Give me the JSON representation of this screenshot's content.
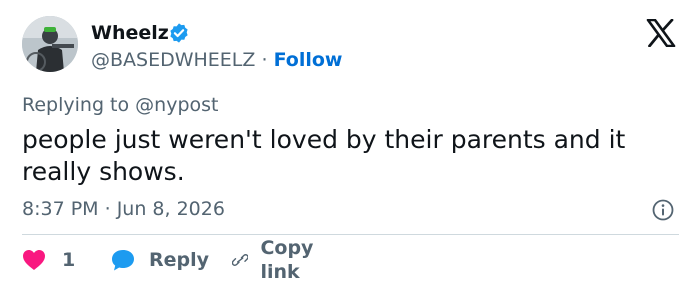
{
  "author": {
    "display_name": "Wheelz",
    "handle": "@BASEDWHEELZ",
    "separator": "·",
    "follow_label": "Follow",
    "verified_icon": "verified-badge-icon",
    "avatar_icon": "avatar"
  },
  "brand": {
    "logo_icon": "x-logo-icon"
  },
  "reply": {
    "prefix": "Replying to",
    "mention": "@nypost"
  },
  "tweet": {
    "text": "people just weren't loved by their parents and it really shows."
  },
  "meta": {
    "time": "8:37 PM",
    "separator": "·",
    "date": "Jun 8, 2026",
    "info_icon": "info-icon"
  },
  "actions": {
    "like_count": "1",
    "reply_label": "Reply",
    "copy_label": "Copy link"
  },
  "colors": {
    "accent": "#006fd6",
    "verified": "#1d9bf0",
    "like": "#f91880",
    "muted": "#536471",
    "text": "#0f1419",
    "divider": "#cfd9de"
  }
}
